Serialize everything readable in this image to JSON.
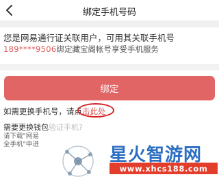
{
  "nav": {
    "title": "绑定手机号码"
  },
  "info": {
    "line1": "您是网易通行证关联用户，可用其关联手机号",
    "phone_masked": "189****9506",
    "line2_rest": "绑定藏宝阁帐号享受手机服务"
  },
  "bind_button": {
    "label": "绑定"
  },
  "change_phone": {
    "prefix": "如需更换手机号，请点",
    "link": "击此处"
  },
  "wallet": {
    "heading": "需要更换钱包",
    "heading_obscured": "验证手机?",
    "line2": "请下载\"网易",
    "line3": "全手机\"中进"
  },
  "watermark": {
    "brand": "星火智游网",
    "url": "www.xhcs188.com"
  },
  "colors": {
    "accent": "#e26565",
    "link": "#e05a5a",
    "annotation_circle": "#d32020",
    "watermark_blue": "#2c6ec2",
    "watermark_red": "#e33e2b"
  },
  "icons": {
    "back": "chevron-left-icon"
  }
}
